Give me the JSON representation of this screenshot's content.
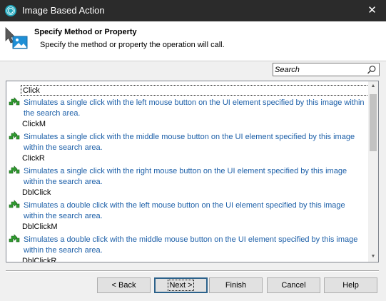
{
  "window": {
    "title": "Image Based Action",
    "close_glyph": "✕"
  },
  "header": {
    "title": "Specify Method or Property",
    "subtitle": "Specify the method or property the operation will call."
  },
  "search": {
    "placeholder": "Search",
    "value": ""
  },
  "methods": [
    {
      "name": "Click",
      "description": "Simulates a single click with the left mouse button on the UI element specified by this image within the search area."
    },
    {
      "name": "ClickM",
      "description": "Simulates a single click with the middle mouse button on the UI element specified by this image within the search area."
    },
    {
      "name": "ClickR",
      "description": "Simulates a single click with the right mouse button on the UI element specified by this image within the search area."
    },
    {
      "name": "DblClick",
      "description": "Simulates a double click with the left mouse button on the UI element specified by this image within the search area."
    },
    {
      "name": "DblClickM",
      "description": "Simulates a double click with the middle mouse button on the UI element specified by this image within the search area."
    },
    {
      "name": "DblClickR",
      "description": ""
    }
  ],
  "buttons": {
    "back": "< Back",
    "next": "Next >",
    "finish": "Finish",
    "cancel": "Cancel",
    "help": "Help"
  },
  "colors": {
    "titlebar": "#2b2b2b",
    "description_text": "#1c5fa8",
    "accent": "#1fa3b8"
  }
}
